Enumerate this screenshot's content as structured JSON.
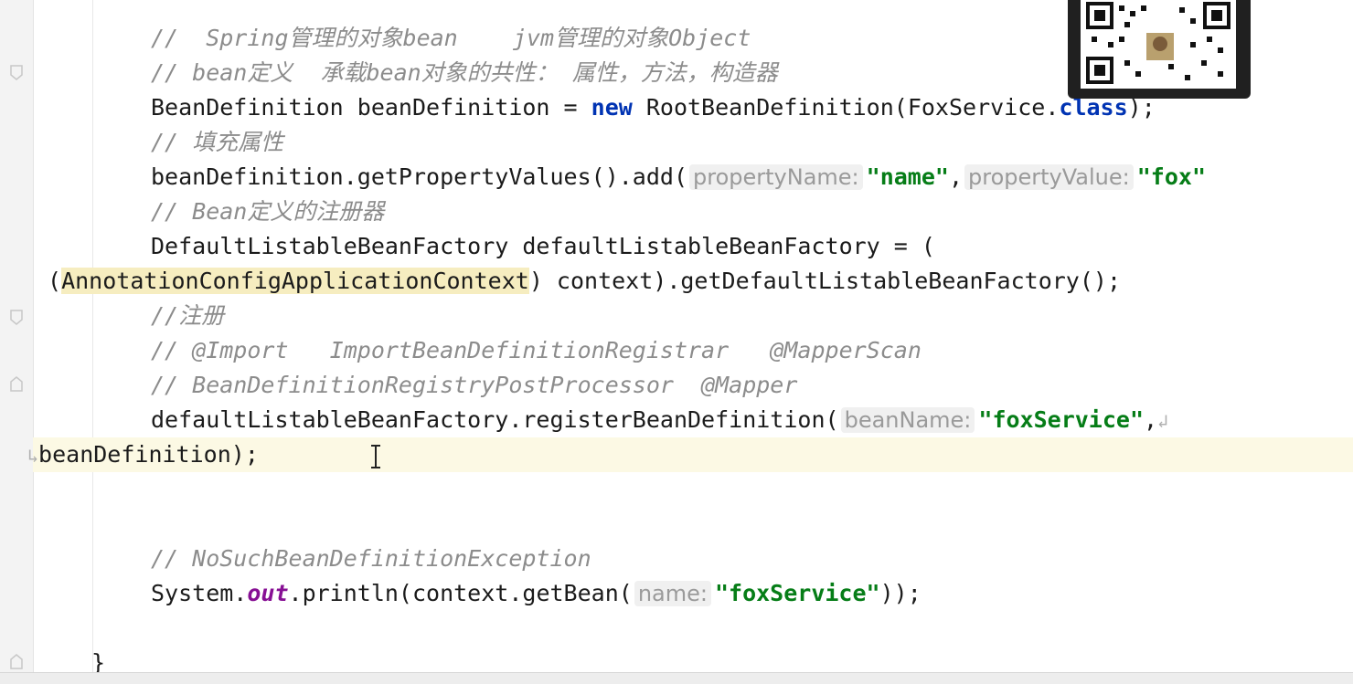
{
  "editor": {
    "c1": "//  Spring管理的对象bean    jvm管理的对象Object",
    "c2": "// bean定义  承载bean对象的共性： 属性，方法，构造器",
    "l3_a": "BeanDefinition beanDefinition = ",
    "l3_kw": "new",
    "l3_b": " RootBeanDefinition(FoxService.",
    "l3_cls": "class",
    "l3_c": ");",
    "c4": "// 填充属性",
    "l5_a": "beanDefinition.getPropertyValues().add(",
    "l5_hint1": "propertyName:",
    "l5_s1": "\"name\"",
    "l5_sep": ",",
    "l5_hint2": "propertyValue:",
    "l5_s2": "\"fox\"",
    "c6": "// Bean定义的注册器",
    "l7": "DefaultListableBeanFactory defaultListableBeanFactory = (",
    "l8_a": "(",
    "l8_hl": "AnnotationConfigApplicationContext",
    "l8_b": ") context).getDefaultListableBeanFactory();",
    "c9": "//注册",
    "c10": "// @Import   ImportBeanDefinitionRegistrar   @MapperScan",
    "c11": "// BeanDefinitionRegistryPostProcessor  @Mapper",
    "l12_a": "defaultListableBeanFactory.registerBeanDefinition(",
    "l12_hint": "beanName:",
    "l12_s": "\"foxService\"",
    "l12_b": ",",
    "l13": "beanDefinition);",
    "c14": "// NoSuchBeanDefinitionException",
    "l15_a": "System.",
    "l15_it": "out",
    "l15_b": ".println(context.getBean(",
    "l15_hint": "name:",
    "l15_s": "\"foxService\"",
    "l15_c": "));",
    "l16": "}"
  },
  "icons": {
    "wrap": "soft-wrap-icon",
    "fold": "fold-marker-icon",
    "caret": "text-cursor-icon",
    "qr": "qr-code-icon"
  }
}
